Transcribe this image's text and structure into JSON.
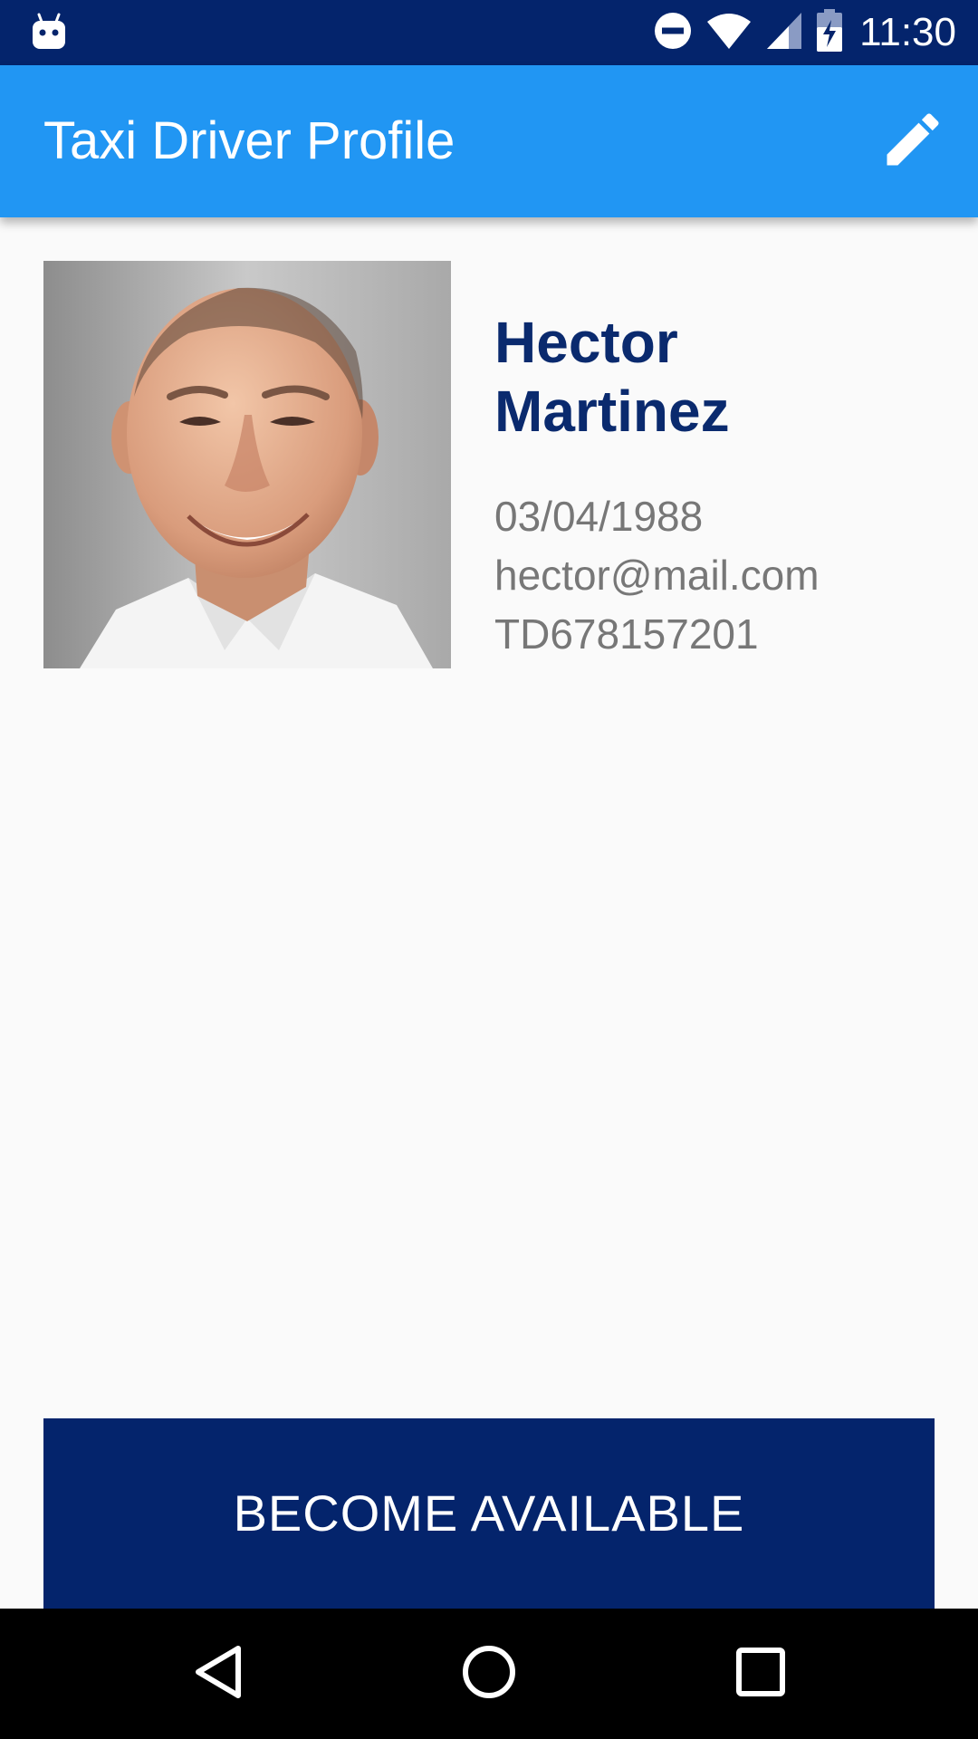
{
  "status_bar": {
    "time": "11:30",
    "icons": [
      "android-icon",
      "do-not-disturb-icon",
      "wifi-icon",
      "cell-signal-icon",
      "battery-charging-icon"
    ]
  },
  "app_bar": {
    "title": "Taxi Driver Profile",
    "action_icon": "edit-icon"
  },
  "profile": {
    "first_name": "Hector",
    "last_name": "Martinez",
    "birth_date": "03/04/1988",
    "email": "hector@mail.com",
    "license_id": "TD678157201"
  },
  "primary_action": {
    "label": "BECOME AVAILABLE"
  },
  "nav_bar": {
    "buttons": [
      "back-icon",
      "home-icon",
      "recents-icon"
    ]
  },
  "colors": {
    "status_bar": "#04246c",
    "app_bar": "#2196f3",
    "name_text": "#0a2a6e",
    "detail_text": "#777777",
    "button": "#04246c",
    "background": "#fafafa"
  }
}
